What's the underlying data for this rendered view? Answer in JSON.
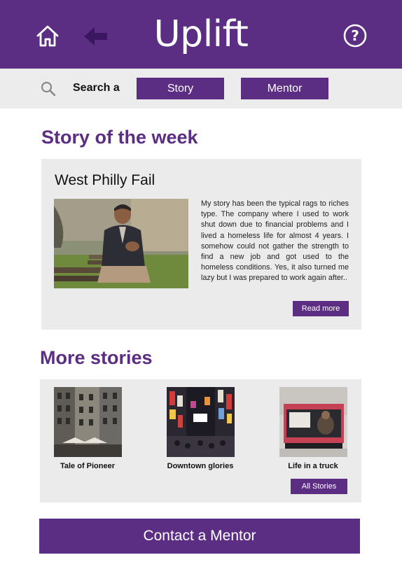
{
  "colors": {
    "brand": "#5b2d83",
    "panel": "#ebebeb",
    "searchbar": "#ececec"
  },
  "header": {
    "title": "Uplift",
    "home_icon": "home-icon",
    "back_icon": "back-arrow-icon",
    "help_icon": "help-circle-icon"
  },
  "search": {
    "icon": "search-icon",
    "label": "Search a",
    "options": [
      "Story",
      "Mentor"
    ]
  },
  "story_of_week": {
    "section_title": "Story of the week",
    "headline": "West Philly Fail",
    "photo": "man-sitting-on-bench-photo",
    "excerpt": "My story has been the typical rags to riches type. The company where I used to work shut down due to financial problems and I lived a homeless life for almost 4 years. I somehow could not gather the strength to find a new job and got used to the homeless conditions. Yes, it also turned me lazy but I was prepared to work again after..",
    "read_more_label": "Read more"
  },
  "more_stories": {
    "section_title": "More stories",
    "items": [
      {
        "title": "Tale of Pioneer",
        "photo": "old-buildings-photo"
      },
      {
        "title": "Downtown glories",
        "photo": "city-signs-photo"
      },
      {
        "title": "Life in a truck",
        "photo": "truck-cab-photo"
      }
    ],
    "all_label": "All Stories"
  },
  "cta": {
    "label": "Contact a Mentor"
  }
}
